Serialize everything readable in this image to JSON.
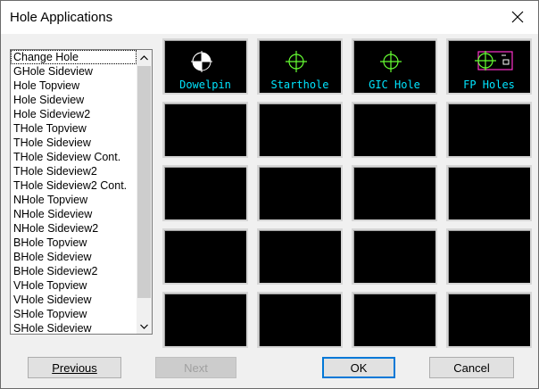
{
  "window": {
    "title": "Hole Applications"
  },
  "list": {
    "items": [
      "Change Hole",
      "GHole Sideview",
      "Hole Topview",
      "Hole Sideview",
      "Hole Sideview2",
      "THole Topview",
      "THole Sideview",
      "THole Sideview Cont.",
      "THole Sideview2",
      "THole Sideview2 Cont.",
      "NHole Topview",
      "NHole Sideview",
      "NHole Sideview2",
      "BHole Topview",
      "BHole Sideview",
      "BHole Sideview2",
      "VHole Topview",
      "VHole Sideview",
      "SHole Topview",
      "SHole Sideview"
    ],
    "selected_index": 0
  },
  "tiles": [
    {
      "label": "Dowelpin",
      "icon": "dowelpin-icon"
    },
    {
      "label": "Starthole",
      "icon": "starthole-icon"
    },
    {
      "label": "GIC Hole",
      "icon": "gic-hole-icon"
    },
    {
      "label": "FP Holes",
      "icon": "fp-holes-icon"
    }
  ],
  "buttons": {
    "previous": "Previous",
    "next": "Next",
    "ok": "OK",
    "cancel": "Cancel"
  },
  "colors": {
    "tile_bg": "#000000",
    "label": "#00e5ff",
    "crosshair": "#66ff33",
    "magenta": "#ff33cc"
  }
}
